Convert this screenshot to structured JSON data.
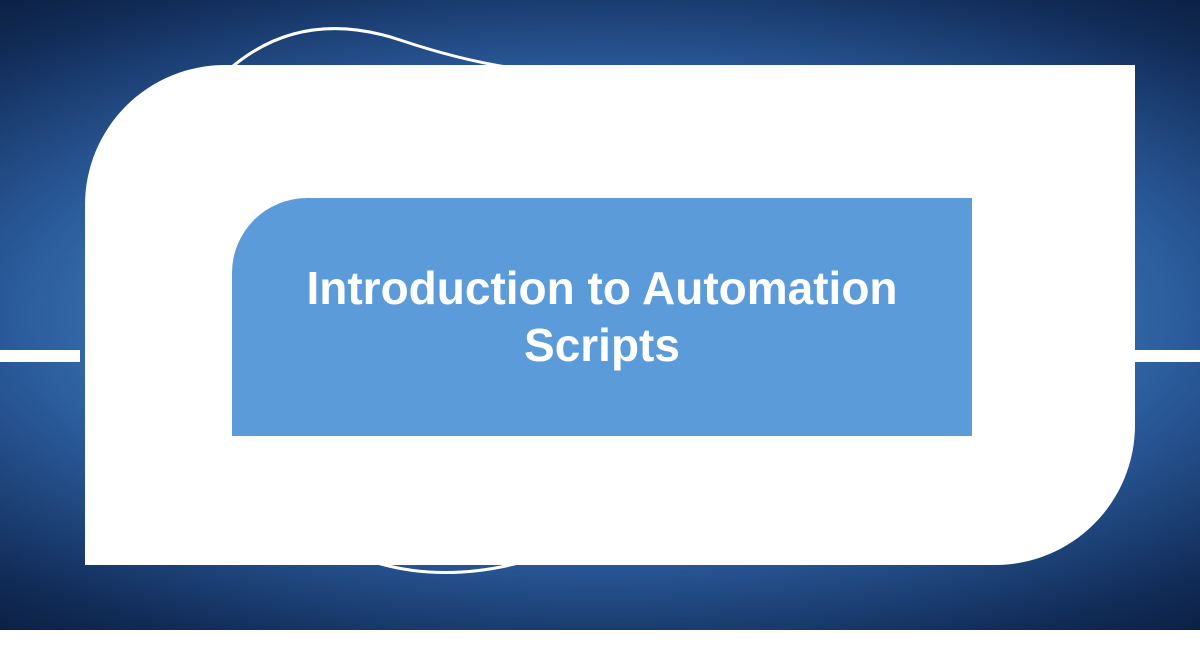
{
  "title": "Introduction to Automation Scripts",
  "colors": {
    "inner_card_bg": "#5c9bd9",
    "outer_card_bg": "#ffffff",
    "text": "#ffffff"
  }
}
